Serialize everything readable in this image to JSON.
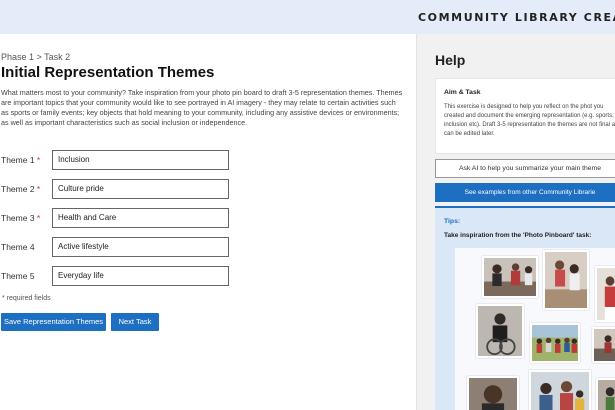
{
  "header": {
    "brand": "COMMUNITY LIBRARY CREAT"
  },
  "main": {
    "breadcrumb": "Phase 1 > Task 2",
    "title": "Initial Representation Themes",
    "intro": "What matters most to your community? Take inspiration from your photo pin board to draft 3-5 representation themes. Themes are important topics that your community would like to see portrayed in AI imagery - they may relate to certain activities such as sports or family events; key objects that hold meaning to your community, including any assistive devices or environments; as well as important characteristics such as social inclusion or independence.",
    "themes": [
      {
        "label": "Theme 1",
        "required": true,
        "value": "Inclusion"
      },
      {
        "label": "Theme 2",
        "required": true,
        "value": "Culture pride"
      },
      {
        "label": "Theme 3",
        "required": true,
        "value": "Health and Care"
      },
      {
        "label": "Theme 4",
        "required": false,
        "value": "Active lifestyle"
      },
      {
        "label": "Theme 5",
        "required": false,
        "value": "Everyday life"
      }
    ],
    "required_mark": "*",
    "required_note": "* required fields",
    "save_label": "Save Representation Themes",
    "next_label": "Next Task"
  },
  "help": {
    "title": "Help",
    "aim_title": "Aim & Task",
    "aim_text": "This exercise is designed to help you reflect on the phot you created and document the emerging representation (e.g. sports, inclusion etc). Draft 3-5 representation the themes are not final and can be edited later.",
    "ai_button": "Ask AI to help you summarize your main theme",
    "examples_button": "See examples from other Community Librarie",
    "tips_title": "Tips:",
    "tips_text": "Take inspiration from the 'Photo Pinboard' task:"
  },
  "colors": {
    "accent": "#1d6fc1",
    "header_bg": "#e3ecf8",
    "tips_bg": "#d9e7f6",
    "required": "#c0392b"
  }
}
